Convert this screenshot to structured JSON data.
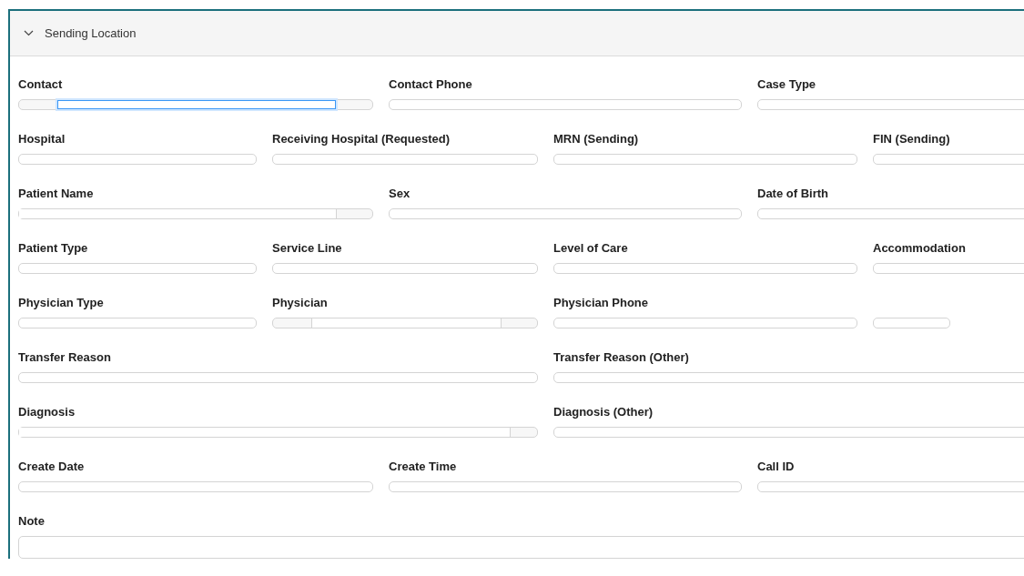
{
  "section": {
    "title": "Sending Location",
    "expanded": true
  },
  "rows": [
    [
      {
        "label": "Contact",
        "kind": "addon-both",
        "focused": true
      },
      {
        "label": "Contact Phone",
        "kind": "plain",
        "focused": false
      },
      {
        "label": "Case Type",
        "kind": "plain",
        "focused": false
      }
    ],
    [
      {
        "label": "Hospital",
        "kind": "plain",
        "focused": false
      },
      {
        "label": "Receiving Hospital (Requested)",
        "kind": "plain",
        "focused": false
      },
      {
        "label": "MRN (Sending)",
        "kind": "plain",
        "focused": false
      },
      {
        "label": "FIN (Sending)",
        "kind": "plain",
        "focused": false
      }
    ],
    [
      {
        "label": "Patient Name",
        "kind": "addon-right",
        "focused": false
      },
      {
        "label": "Sex",
        "kind": "plain",
        "focused": false
      },
      {
        "label": "Date of Birth",
        "kind": "plain",
        "focused": false
      }
    ],
    [
      {
        "label": "Patient Type",
        "kind": "plain",
        "focused": false
      },
      {
        "label": "Service Line",
        "kind": "plain",
        "focused": false
      },
      {
        "label": "Level of Care",
        "kind": "plain",
        "focused": false
      },
      {
        "label": "Accommodation",
        "kind": "plain",
        "focused": false
      }
    ],
    [
      {
        "label": "Physician Type",
        "kind": "plain",
        "focused": false
      },
      {
        "label": "Physician",
        "kind": "addon-both",
        "focused": false
      },
      {
        "label": "Physician Phone",
        "kind": "plain",
        "focused": false
      },
      {
        "kind": "plain",
        "focused": false
      }
    ],
    [
      {
        "label": "Transfer Reason",
        "kind": "plain",
        "focused": false
      },
      {
        "label": "Transfer Reason (Other)",
        "kind": "plain",
        "focused": false
      }
    ],
    [
      {
        "label": "Diagnosis",
        "kind": "addon-right",
        "focused": false
      },
      {
        "label": "Diagnosis (Other)",
        "kind": "plain",
        "focused": false
      }
    ],
    [
      {
        "label": "Create Date",
        "kind": "plain",
        "focused": false
      },
      {
        "label": "Create Time",
        "kind": "plain",
        "focused": false
      },
      {
        "label": "Call ID",
        "kind": "plain",
        "focused": false
      }
    ],
    [
      {
        "label": "Note",
        "kind": "multiline",
        "focused": false
      }
    ]
  ]
}
